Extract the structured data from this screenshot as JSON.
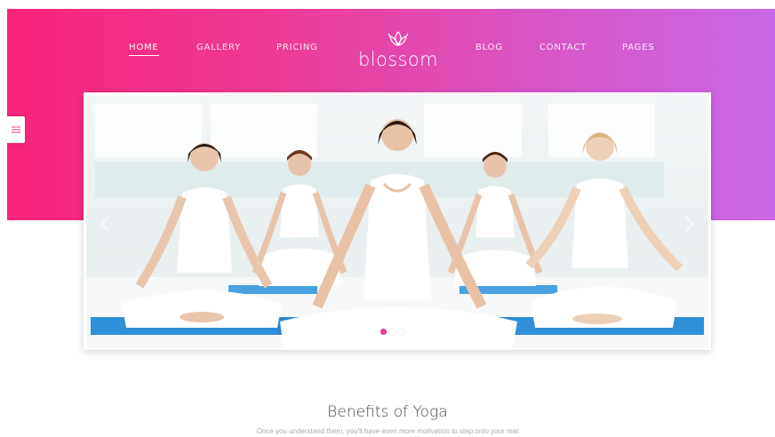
{
  "nav": {
    "left": [
      {
        "label": "HOME",
        "active": true
      },
      {
        "label": "GALLERY"
      },
      {
        "label": "PRICING"
      }
    ],
    "right": [
      {
        "label": "BLOG"
      },
      {
        "label": "CONTACT"
      },
      {
        "label": "PAGES"
      }
    ]
  },
  "logo": {
    "text": "blossom",
    "icon": "lotus-icon"
  },
  "side_tab": {
    "icon": "menu-lines-icon"
  },
  "slider": {
    "slide_count": 3,
    "active_index": 0,
    "prev_icon": "chevron-left-icon",
    "next_icon": "chevron-right-icon"
  },
  "section": {
    "title": "Benefits of Yoga",
    "subtitle": "Once you understand them, you'll have even more motivation to step onto your mat"
  },
  "colors": {
    "gradient_start": "#f8237a",
    "gradient_end": "#c968e6",
    "accent": "#ee3a94"
  }
}
